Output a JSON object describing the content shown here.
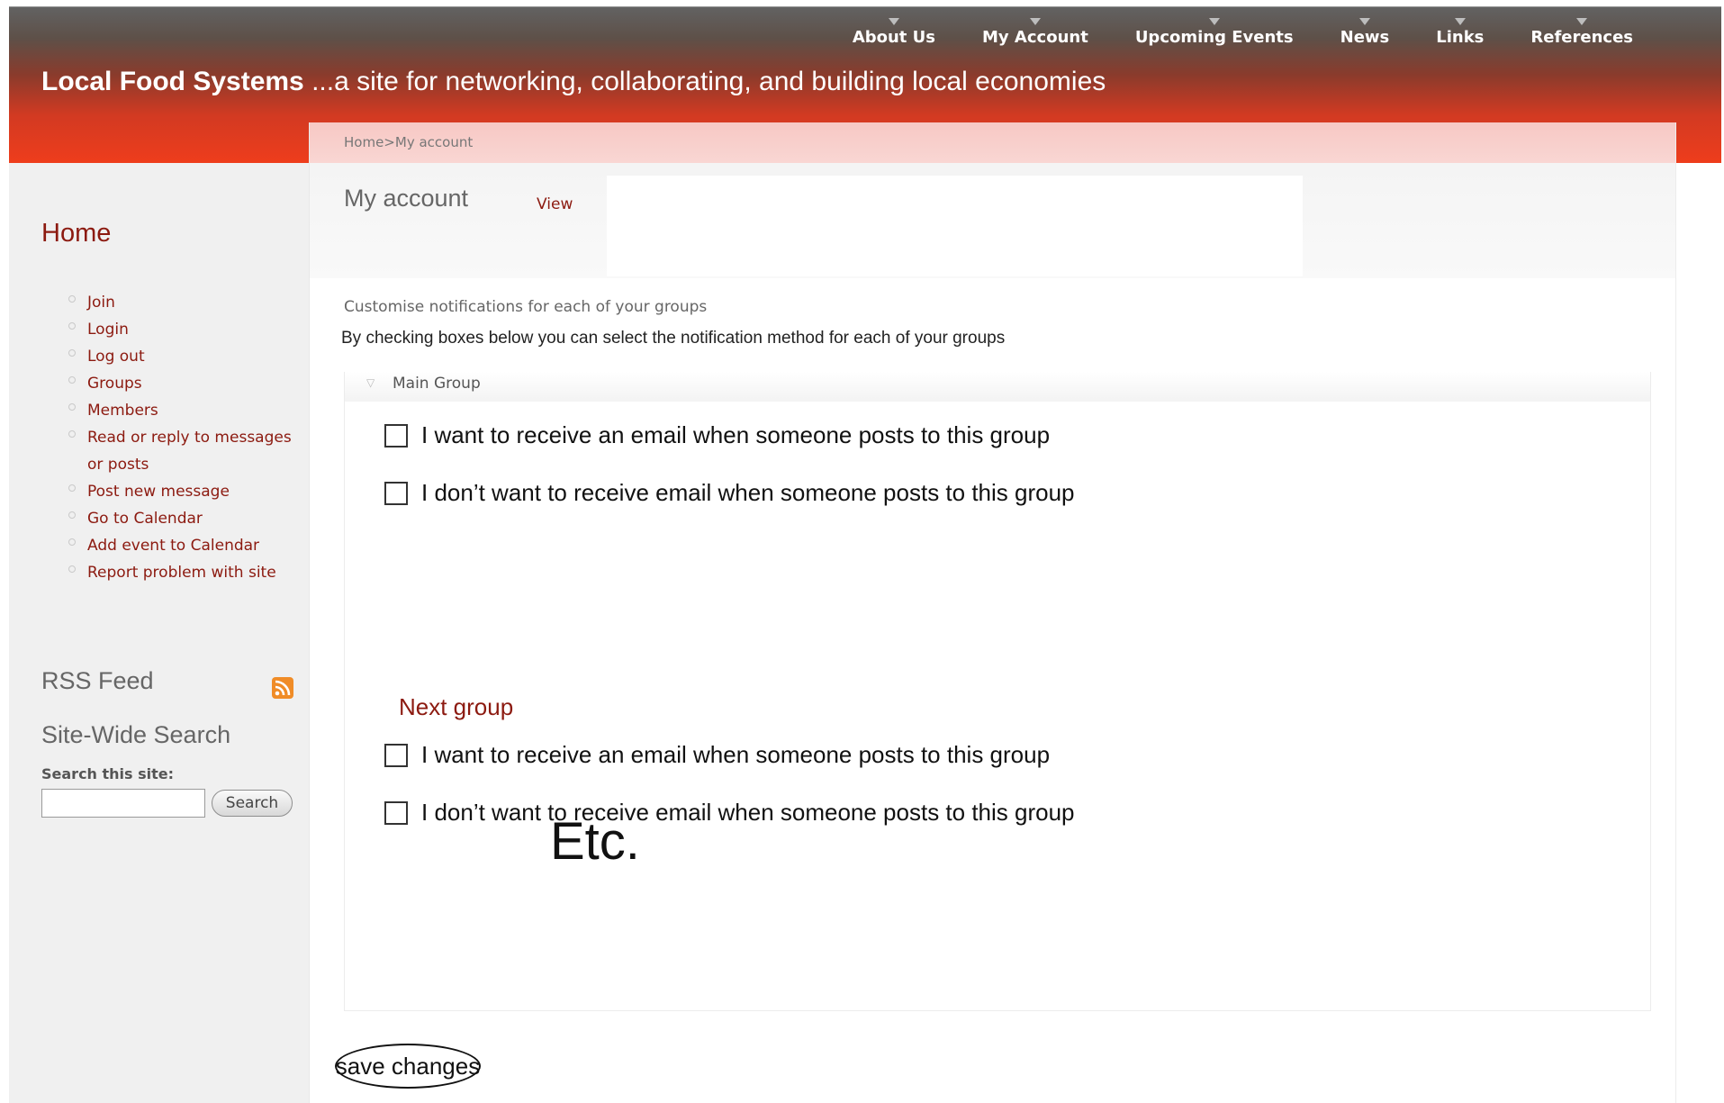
{
  "header": {
    "site_name": "Local Food Systems",
    "tagline": " ...a site for networking, collaborating, and building local economies",
    "nav": [
      "About Us",
      "My Account",
      "Upcoming Events",
      "News",
      "Links",
      "References"
    ]
  },
  "breadcrumb": {
    "home": "Home",
    "separator": ">",
    "current": "My account"
  },
  "page": {
    "title": "My account",
    "tab_view": "View"
  },
  "sidebar": {
    "home": "Home",
    "links": [
      "Join",
      "Login",
      "Log out",
      "Groups",
      "Members",
      "Read or reply to messages or posts",
      "Post new message",
      "Go to Calendar",
      "Add event to Calendar",
      "Report problem with site"
    ],
    "rss_title": "RSS Feed",
    "search_title": "Site-Wide Search",
    "search_label": "Search this site:",
    "search_value": "",
    "search_button": "Search"
  },
  "notifications": {
    "heading": "Customise notifications for each of your groups",
    "instructions": "By checking boxes below you can select the notification method for each of your groups",
    "main_group": {
      "label": "Main Group",
      "options": [
        "I want to receive an email when someone posts to this group",
        "I don’t want to receive email when someone posts to this group"
      ]
    },
    "next_group": {
      "label": "Next group",
      "options": [
        "I want to receive an email when someone posts to this group",
        "I don’t want to receive email when someone posts to this group"
      ]
    },
    "etc": "Etc.",
    "save_button": "save changes"
  },
  "colors": {
    "accent_red": "#8c1a10",
    "header_top": "#626262",
    "header_bottom": "#ef3d1c",
    "breadcrumb_bg": "#f7c8c4",
    "rss_orange": "#f08c27"
  }
}
